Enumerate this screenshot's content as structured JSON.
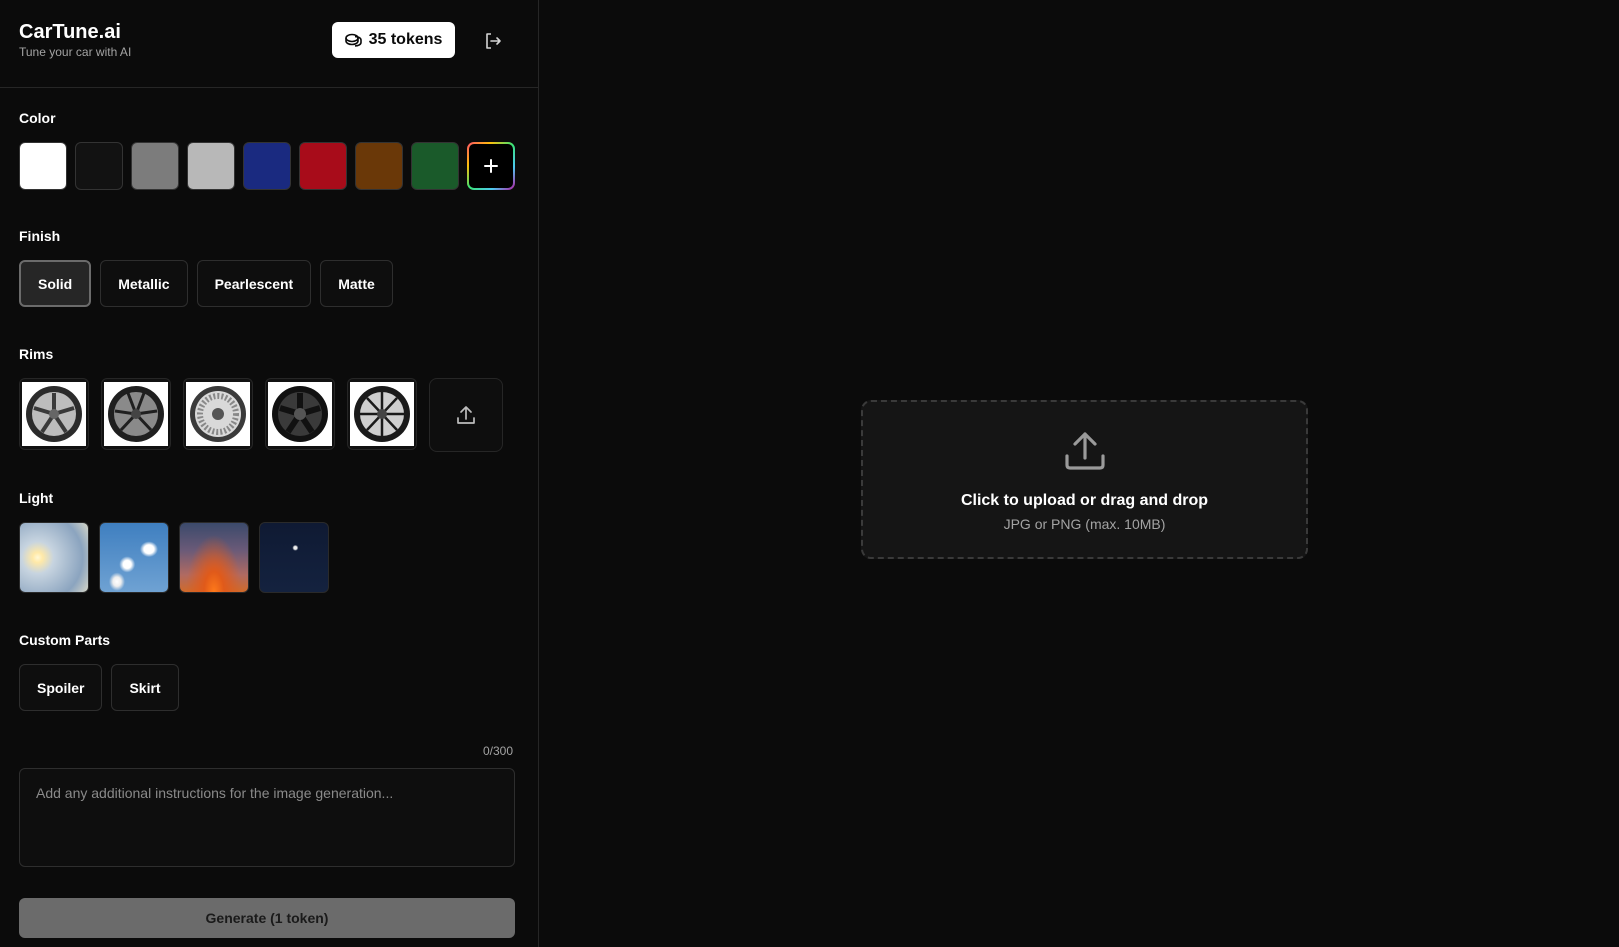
{
  "brand": {
    "title": "CarTune.ai",
    "subtitle": "Tune your car with AI"
  },
  "tokens": {
    "label": "35 tokens",
    "icon": "coins-icon"
  },
  "logout": {
    "icon": "logout-icon"
  },
  "color": {
    "label": "Color",
    "swatches": [
      "#ffffff",
      "#121212",
      "#7c7c7c",
      "#b8b8b8",
      "#1a2a80",
      "#a80c1a",
      "#6a3808",
      "#1a5a2a"
    ],
    "add_icon": "plus-icon"
  },
  "finish": {
    "label": "Finish",
    "options": [
      "Solid",
      "Metallic",
      "Pearlescent",
      "Matte"
    ],
    "selected": "Solid"
  },
  "rims": {
    "label": "Rims",
    "upload_icon": "upload-icon"
  },
  "light": {
    "label": "Light",
    "options": [
      "sun",
      "cloudy",
      "sunset",
      "night"
    ]
  },
  "custom_parts": {
    "label": "Custom Parts",
    "options": [
      "Spoiler",
      "Skirt"
    ]
  },
  "instructions": {
    "counter": "0/300",
    "placeholder": "Add any additional instructions for the image generation..."
  },
  "generate": {
    "label": "Generate (1 token)"
  },
  "upload": {
    "title": "Click to upload or drag and drop",
    "subtitle": "JPG or PNG (max. 10MB)",
    "icon": "upload-icon"
  }
}
